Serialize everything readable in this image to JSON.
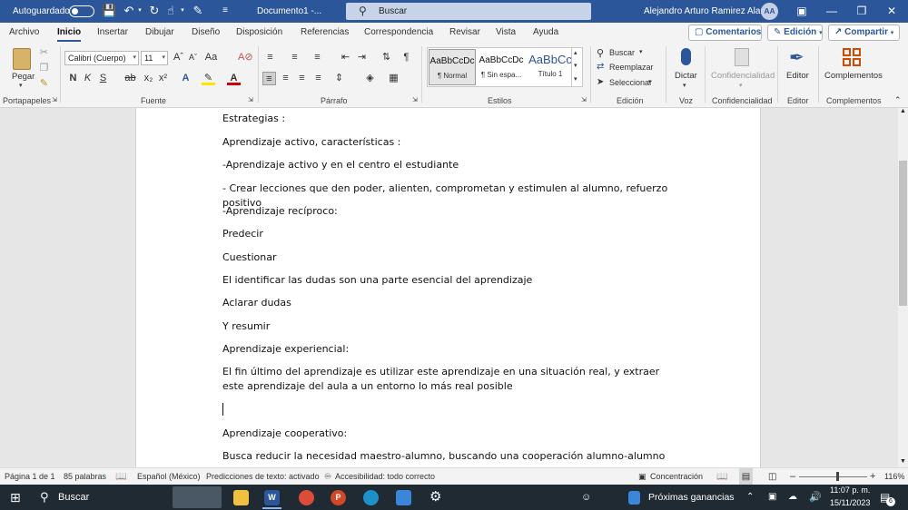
{
  "titlebar": {
    "autosave_label": "Autoguardado",
    "doc_title": "Documento1  -...",
    "search_placeholder": "Buscar",
    "user_name": "Alejandro Arturo Ramirez Alanis",
    "user_initials": "AA",
    "color": "#2b579a"
  },
  "tabs": [
    "Archivo",
    "Inicio",
    "Insertar",
    "Dibujar",
    "Diseño",
    "Disposición",
    "Referencias",
    "Correspondencia",
    "Revisar",
    "Vista",
    "Ayuda"
  ],
  "active_tab": "Inicio",
  "top_buttons": {
    "comments": "Comentarios",
    "editing": "Edición",
    "share": "Compartir"
  },
  "ribbon": {
    "clipboard": {
      "paste": "Pegar",
      "group": "Portapapeles"
    },
    "font": {
      "name": "Calibri (Cuerpo)",
      "size": "11",
      "group": "Fuente"
    },
    "paragraph": {
      "group": "Párrafo"
    },
    "styles": {
      "group": "Estilos",
      "items": [
        {
          "preview": "AaBbCcDc",
          "name": "¶ Normal"
        },
        {
          "preview": "AaBbCcDc",
          "name": "¶ Sin espa..."
        },
        {
          "preview": "AaBbCc",
          "name": "Título 1"
        }
      ]
    },
    "editing": {
      "find": "Buscar",
      "replace": "Reemplazar",
      "select": "Seleccionar",
      "group": "Edición"
    },
    "voice": {
      "dictate": "Dictar",
      "group": "Voz"
    },
    "sensitivity": {
      "label": "Confidencialidad",
      "group": "Confidencialidad"
    },
    "editor": {
      "label": "Editor",
      "group": "Editor"
    },
    "addins": {
      "label": "Complementos",
      "group": "Complementos"
    }
  },
  "document": {
    "paragraphs": [
      "Estrategias :",
      "Aprendizaje activo, características :",
      "-Aprendizaje activo y en el centro el estudiante",
      "- Crear lecciones que den poder, alienten, comprometan y estimulen al alumno, refuerzo positivo",
      "-Aprendizaje recíproco:",
      "Predecir",
      "Cuestionar",
      "El identificar las dudas son una parte esencial del aprendizaje",
      "Aclarar dudas",
      "Y resumir",
      "Aprendizaje experiencial:",
      "El fin último del aprendizaje es utilizar este aprendizaje en una situación real, y extraer este aprendizaje del aula a un entorno lo más real posible",
      "Aprendizaje cooperativo:",
      "Busca reducir la necesidad maestro-alumno, buscando una cooperación alumno-alumno"
    ]
  },
  "status": {
    "page": "Página 1 de 1",
    "words": "85 palabras",
    "language": "Español (México)",
    "predictions": "Predicciones de texto: activado",
    "accessibility": "Accesibilidad: todo correcto",
    "focus": "Concentración",
    "zoom": "116%",
    "zoom_value": 116
  },
  "taskbar": {
    "search": "Buscar",
    "news": "Próximas ganancias",
    "time": "11:07 p. m.",
    "date": "15/11/2023",
    "notifications": "6"
  }
}
